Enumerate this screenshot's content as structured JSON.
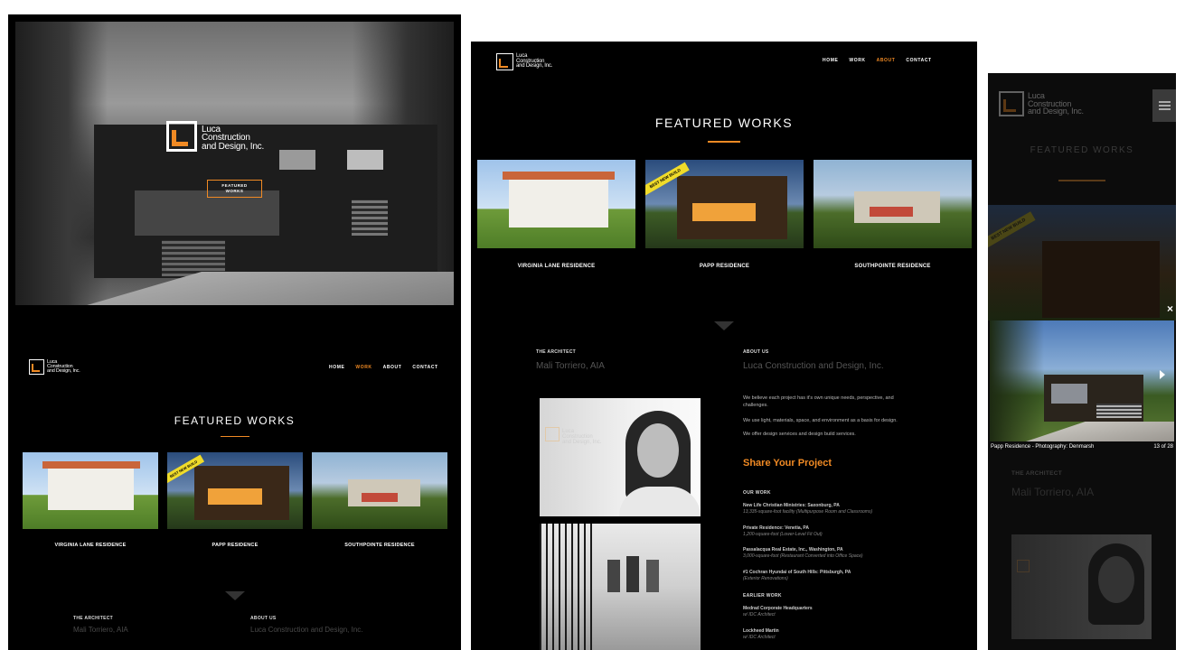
{
  "brand": {
    "line1": "Luca",
    "line2": "Construction",
    "line3": "and Design, Inc."
  },
  "colors": {
    "accent": "#f08a24",
    "background": "#000000"
  },
  "hero": {
    "button_label_1": "FEATURED",
    "button_label_2": "WORKS"
  },
  "nav": {
    "home": "HOME",
    "work": "WORK",
    "about": "ABOUT",
    "contact": "CONTACT"
  },
  "featured": {
    "title": "FEATURED WORKS",
    "items": [
      {
        "caption": "VIRGINIA LANE RESIDENCE"
      },
      {
        "caption": "PAPP RESIDENCE",
        "ribbon": "BEST NEW BUILD"
      },
      {
        "caption": "SOUTHPOINTE RESIDENCE"
      }
    ]
  },
  "about": {
    "architect_label": "THE ARCHITECT",
    "architect_name": "Mali Torriero, AIA",
    "about_label": "ABOUT US",
    "about_name": "Luca Construction and Design, Inc.",
    "paragraphs": [
      "We believe each project has it's own unique needs, perspective, and challenges.",
      "We use light, materials, space, and environment as a basis for design.",
      "We offer design services and design build services."
    ],
    "share_link": "Share Your Project",
    "our_work_label": "OUR WORK",
    "our_work": [
      {
        "title": "New Life Christian Ministries: Saxonburg, PA",
        "sub": "13,335-square-foot facility (Multipurpose Room and Classrooms)"
      },
      {
        "title": "Private Residence: Venetia, PA",
        "sub": "1,200-square-foot (Lower-Level Fit Out)"
      },
      {
        "title": "Passalacqua Real Estate, Inc., Washington, PA",
        "sub": "3,000-square-foot (Restaurant Converted into Office Space)"
      },
      {
        "title": "#1 Cochran Hyundai of South Hills: Pittsburgh, PA",
        "sub": "(Exterior Renovations)"
      }
    ],
    "earlier_work_label": "EARLIER WORK",
    "earlier_work": [
      {
        "title": "Medrad Corporate Headquarters",
        "sub": "w/ IDC Architect"
      },
      {
        "title": "Lockheed Martin",
        "sub": "w/ IDC Architect"
      }
    ]
  },
  "lightbox": {
    "caption": "Papp Residence - Photography: Denmarsh",
    "counter": "13 of 28",
    "close_icon": "×"
  }
}
